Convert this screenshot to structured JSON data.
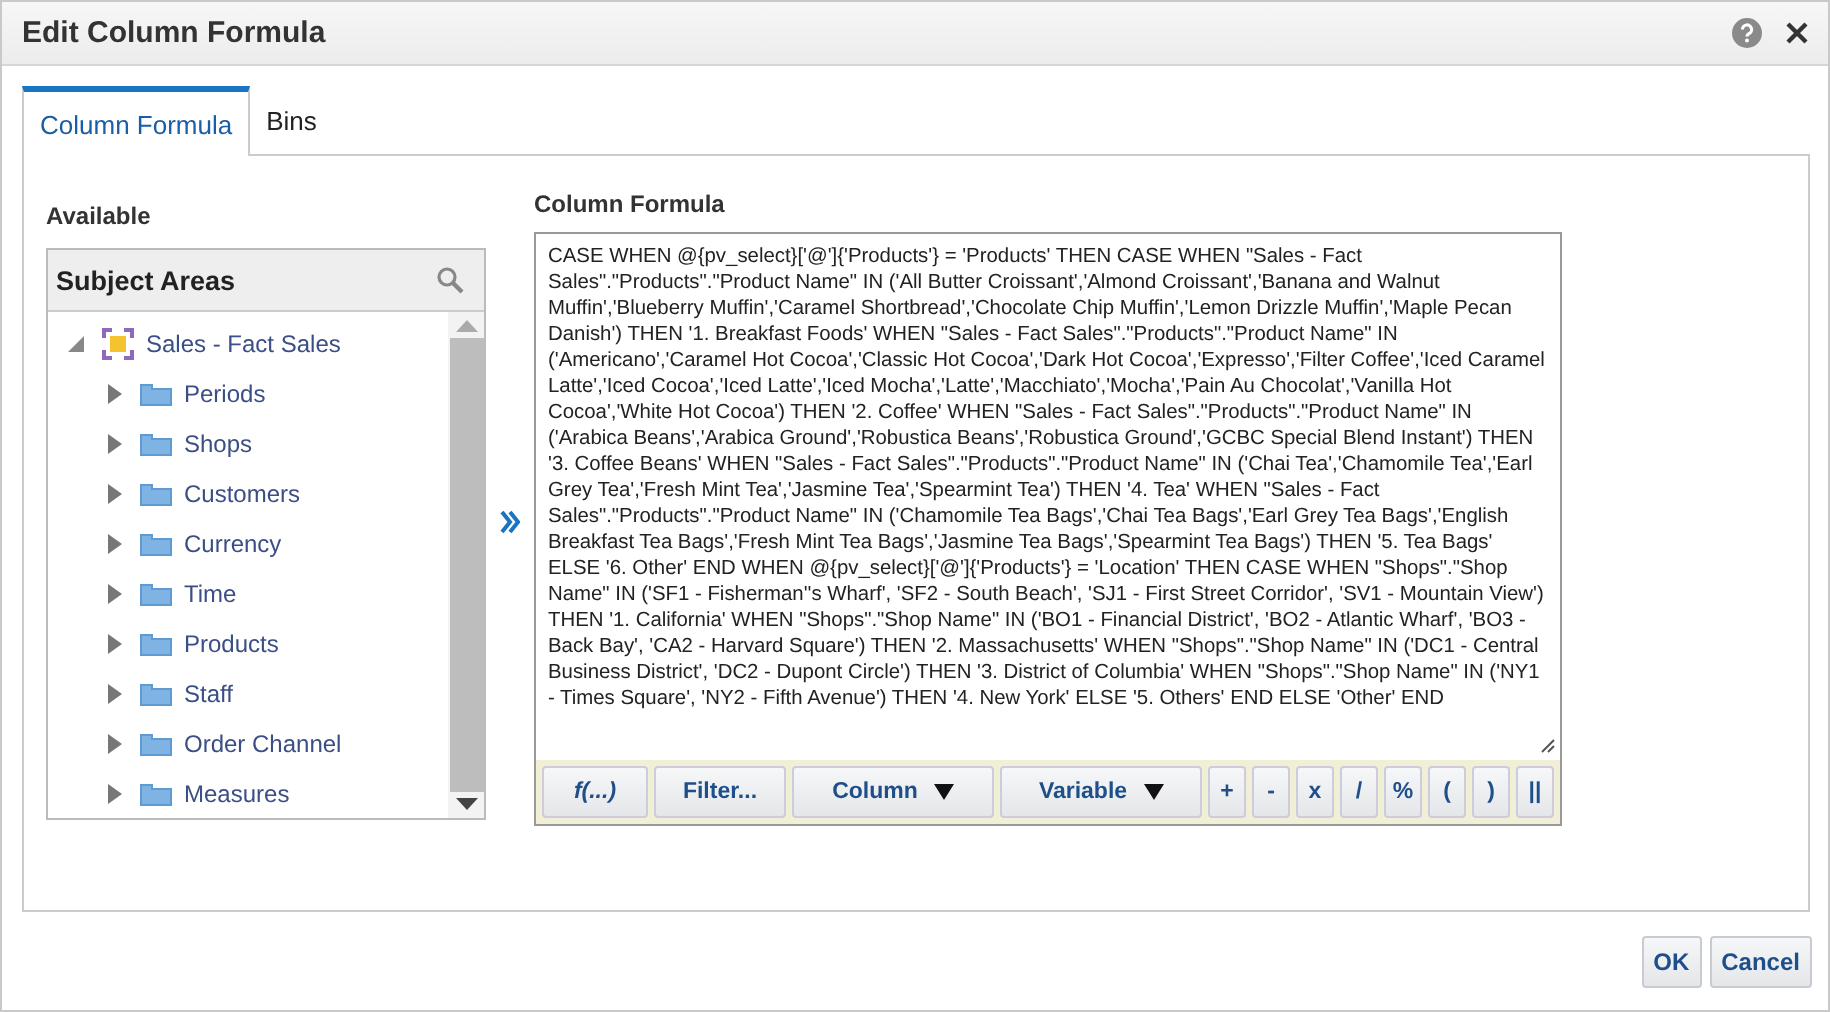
{
  "window": {
    "title": "Edit Column Formula"
  },
  "tabs": [
    {
      "label": "Column Formula",
      "selected": true
    },
    {
      "label": "Bins",
      "selected": false
    }
  ],
  "available": {
    "label": "Available",
    "panel_title": "Subject Areas",
    "tree": [
      {
        "label": "Sales - Fact Sales",
        "kind": "subject-area",
        "expanded": true,
        "children": [
          {
            "label": "Periods",
            "kind": "folder",
            "expanded": false
          },
          {
            "label": "Shops",
            "kind": "folder",
            "expanded": false
          },
          {
            "label": "Customers",
            "kind": "folder",
            "expanded": false
          },
          {
            "label": "Currency",
            "kind": "folder",
            "expanded": false
          },
          {
            "label": "Time",
            "kind": "folder",
            "expanded": false
          },
          {
            "label": "Products",
            "kind": "folder",
            "expanded": false
          },
          {
            "label": "Staff",
            "kind": "folder",
            "expanded": false
          },
          {
            "label": "Order Channel",
            "kind": "folder",
            "expanded": false
          },
          {
            "label": "Measures",
            "kind": "folder",
            "expanded": false
          }
        ]
      }
    ]
  },
  "formula": {
    "label": "Column Formula",
    "value": "CASE WHEN @{pv_select}['@']{'Products'} = 'Products' THEN  CASE WHEN \"Sales - Fact Sales\".\"Products\".\"Product Name\" IN ('All Butter Croissant','Almond Croissant','Banana and Walnut Muffin','Blueberry Muffin','Caramel Shortbread','Chocolate Chip Muffin','Lemon Drizzle Muffin','Maple Pecan Danish') THEN '1. Breakfast Foods' WHEN \"Sales - Fact Sales\".\"Products\".\"Product Name\" IN ('Americano','Caramel Hot Cocoa','Classic Hot Cocoa','Dark Hot Cocoa','Expresso','Filter Coffee','Iced Caramel Latte','Iced Cocoa','Iced Latte','Iced Mocha','Latte','Macchiato','Mocha','Pain Au Chocolat','Vanilla Hot Cocoa','White Hot Cocoa') THEN '2. Coffee' WHEN \"Sales - Fact Sales\".\"Products\".\"Product Name\" IN ('Arabica Beans','Arabica Ground','Robustica Beans','Robustica Ground','GCBC Special Blend Instant') THEN '3. Coffee Beans' WHEN \"Sales - Fact Sales\".\"Products\".\"Product Name\" IN ('Chai Tea','Chamomile Tea','Earl Grey Tea','Fresh Mint Tea','Jasmine Tea','Spearmint Tea') THEN '4. Tea' WHEN \"Sales - Fact Sales\".\"Products\".\"Product Name\" IN ('Chamomile Tea Bags','Chai Tea Bags','Earl Grey Tea Bags','English Breakfast Tea Bags','Fresh Mint Tea Bags','Jasmine Tea Bags','Spearmint Tea Bags') THEN '5. Tea Bags' ELSE '6. Other' END  WHEN @{pv_select}['@']{'Products'} = 'Location' THEN  CASE  WHEN \"Shops\".\"Shop Name\" IN ('SF1 - Fisherman''s Wharf', 'SF2 - South Beach', 'SJ1 - First Street Corridor', 'SV1 - Mountain View') THEN '1. California' WHEN \"Shops\".\"Shop Name\" IN ('BO1 - Financial District', 'BO2 - Atlantic Wharf', 'BO3 - Back Bay', 'CA2 - Harvard Square') THEN '2. Massachusetts' WHEN \"Shops\".\"Shop Name\" IN ('DC1 - Central Business District', 'DC2 - Dupont Circle') THEN '3. District of Columbia' WHEN \"Shops\".\"Shop Name\" IN ('NY1 - Times Square', 'NY2 - Fifth Avenue') THEN '4. New York' ELSE '5. Others' END   ELSE 'Other' END",
    "tools": [
      {
        "label": "f(...)",
        "kind": "function"
      },
      {
        "label": "Filter...",
        "kind": "plain"
      },
      {
        "label": "Column",
        "kind": "dropdown"
      },
      {
        "label": "Variable",
        "kind": "dropdown"
      },
      {
        "label": "+",
        "kind": "plain"
      },
      {
        "label": "-",
        "kind": "plain"
      },
      {
        "label": "x",
        "kind": "plain"
      },
      {
        "label": "/",
        "kind": "plain"
      },
      {
        "label": "%",
        "kind": "plain"
      },
      {
        "label": "(",
        "kind": "plain"
      },
      {
        "label": ")",
        "kind": "plain"
      },
      {
        "label": "||",
        "kind": "plain"
      }
    ]
  },
  "buttons": [
    "OK",
    "Cancel"
  ]
}
